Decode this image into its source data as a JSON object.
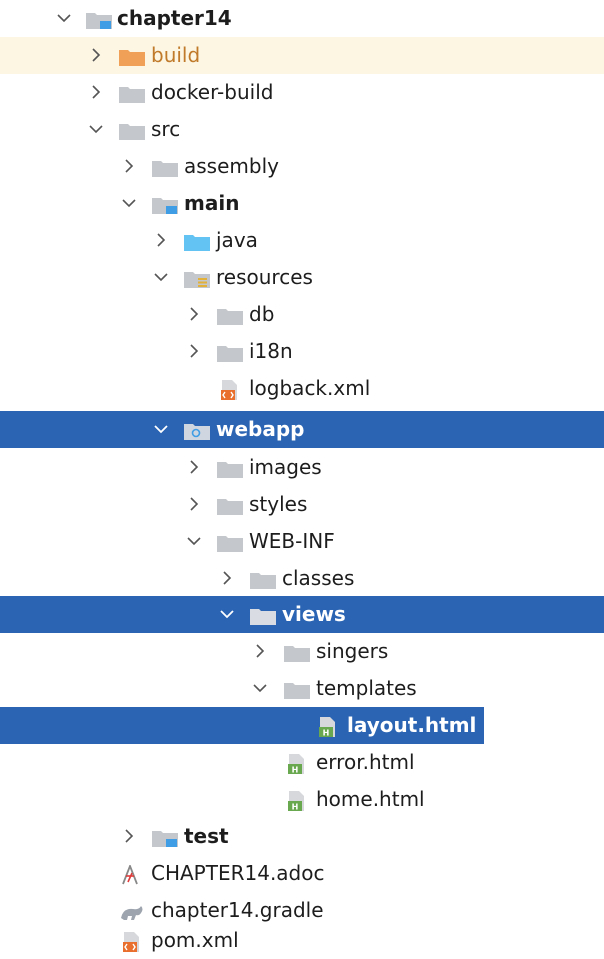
{
  "tree": {
    "project": "chapter14",
    "build": "build",
    "docker_build": "docker-build",
    "src": "src",
    "assembly": "assembly",
    "main": "main",
    "java": "java",
    "resources": "resources",
    "db": "db",
    "i18n": "i18n",
    "logback": "logback.xml",
    "webapp": "webapp",
    "images": "images",
    "styles": "styles",
    "web_inf": "WEB-INF",
    "classes": "classes",
    "views": "views",
    "singers": "singers",
    "templates": "templates",
    "layout": "layout.html",
    "error": "error.html",
    "home": "home.html",
    "test": "test",
    "adoc": "CHAPTER14.adoc",
    "gradle": "chapter14.gradle",
    "pom": "pom.xml"
  },
  "icons": {
    "folder": "folder-icon",
    "module_folder": "module-folder-icon",
    "excluded_folder": "excluded-folder-icon",
    "source_folder": "source-root-folder-icon",
    "resources_folder": "resources-root-folder-icon",
    "web_folder": "web-folder-icon",
    "xml_file": "xml-file-icon",
    "html_file": "html-file-icon",
    "asciidoc_file": "asciidoc-file-icon",
    "gradle_file": "gradle-file-icon",
    "maven_file": "maven-file-icon",
    "chevron_right": "chevron-right-icon",
    "chevron_down": "chevron-down-icon"
  },
  "colors": {
    "selection": "#2a64b3",
    "excluded_highlight": "#fcf6e3",
    "folder_gray": "#c4c7cc",
    "module_blue": "#3f9de6",
    "excluded_orange": "#f0a057",
    "source_blue": "#63c3f2",
    "html_green": "#6aa84f",
    "xml_orange": "#e86f2d"
  }
}
